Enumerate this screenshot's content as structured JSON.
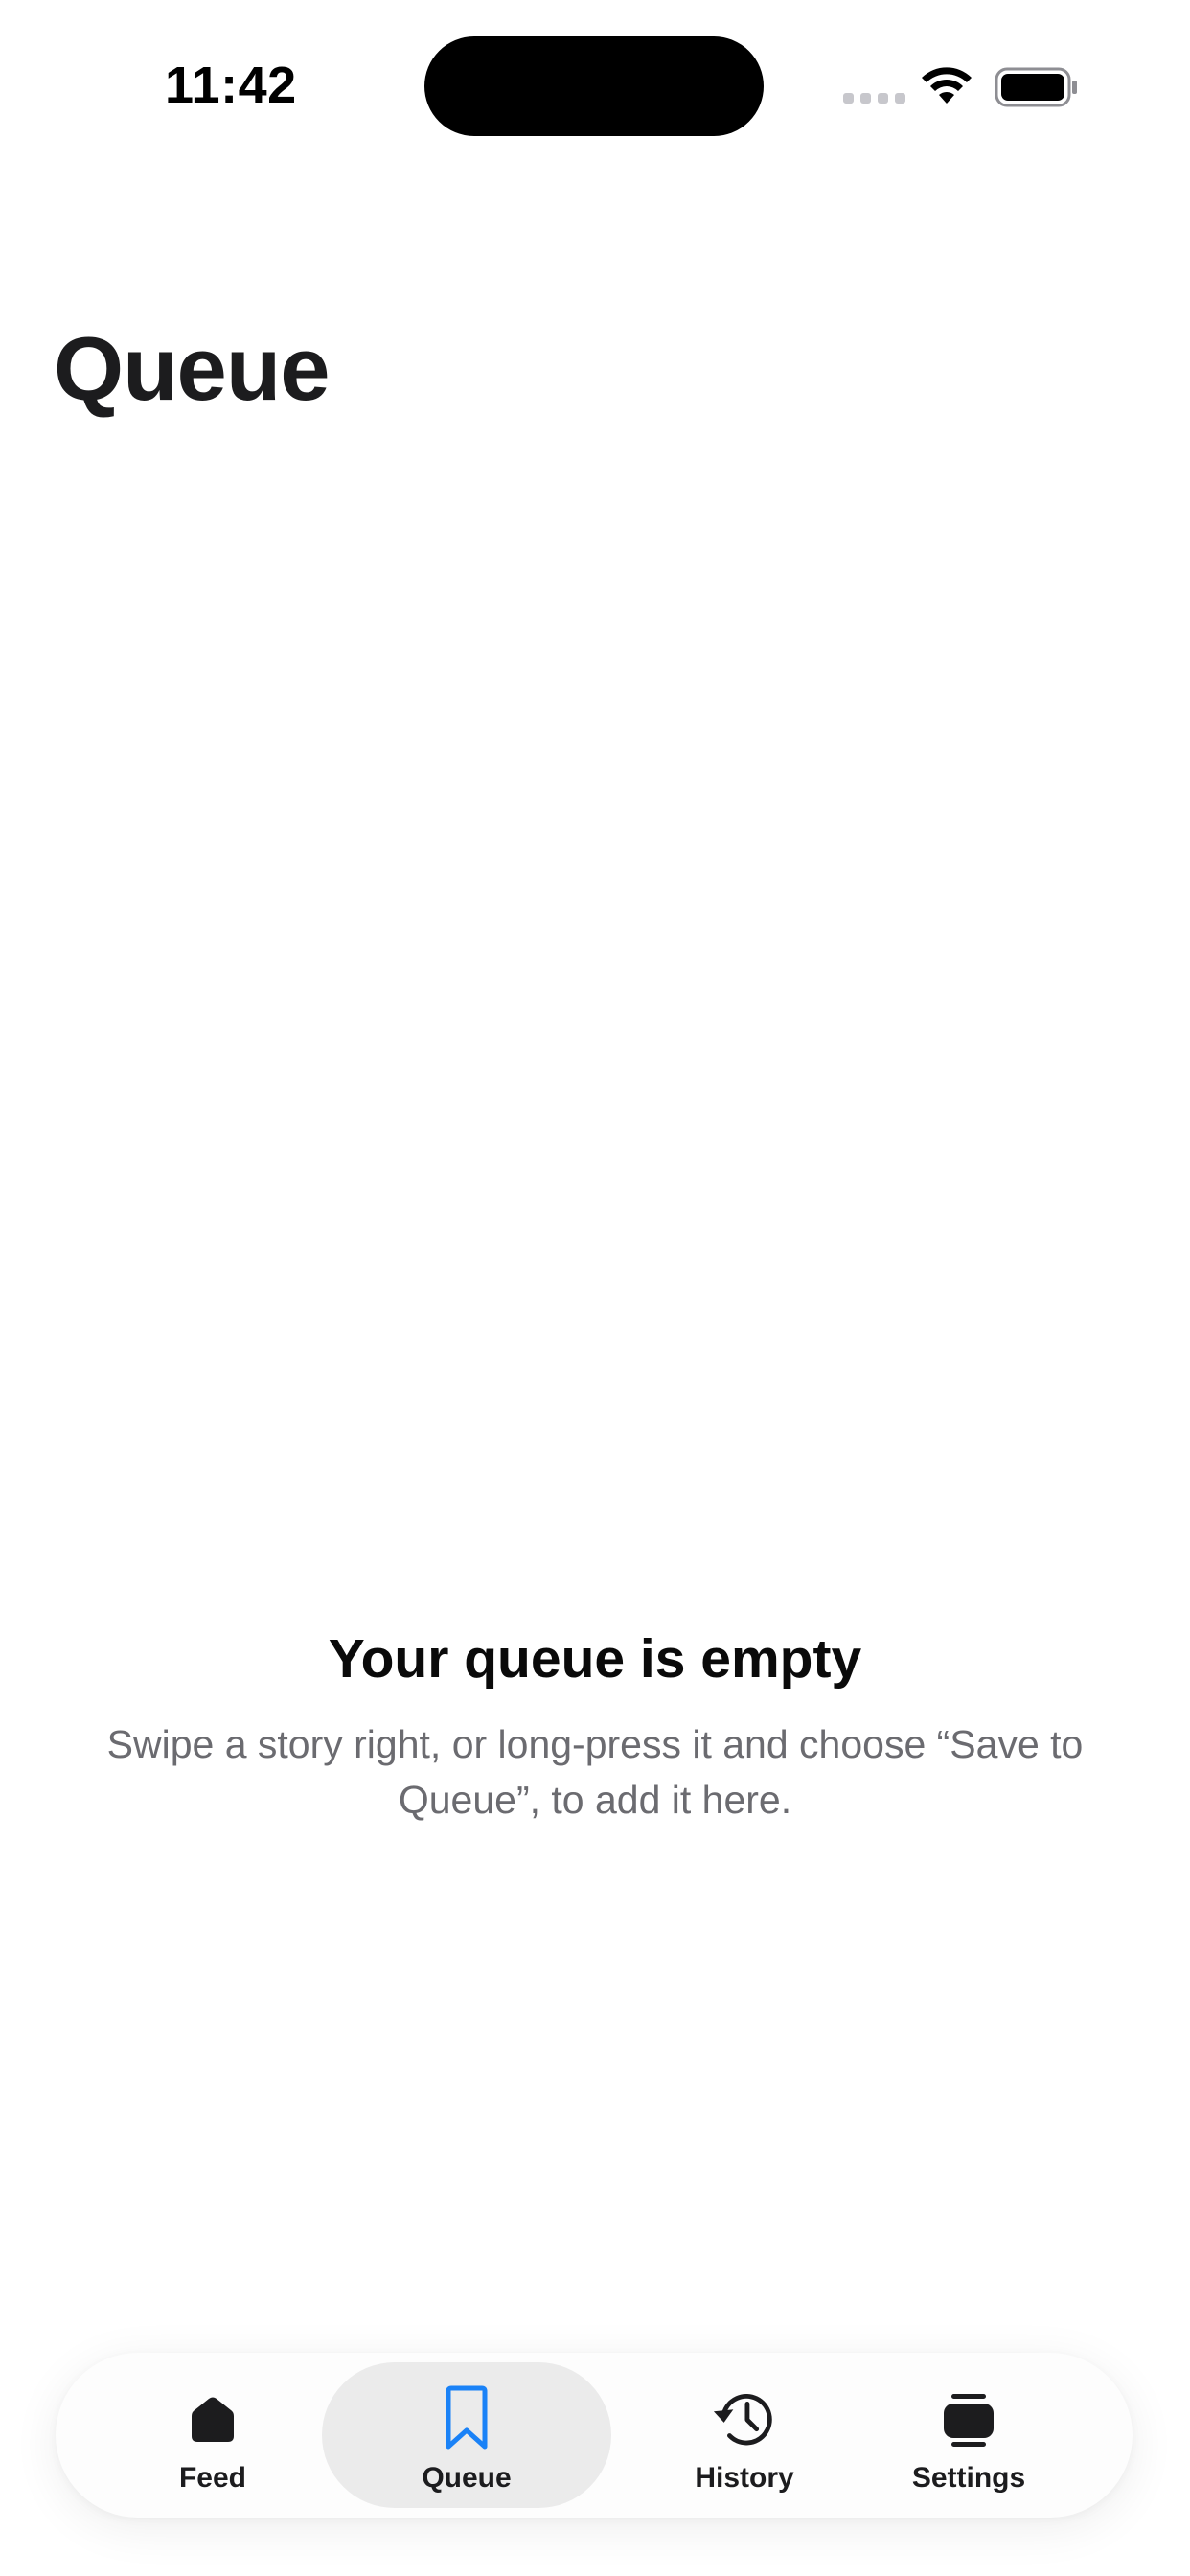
{
  "status_bar": {
    "time": "11:42",
    "icons": [
      "signal-dots-icon",
      "wifi-icon",
      "battery-icon"
    ]
  },
  "page": {
    "title": "Queue"
  },
  "empty_state": {
    "title": "Your queue is empty",
    "description": "Swipe a story right, or long-press it and choose “Save to Queue”, to add it here."
  },
  "tab_bar": {
    "active": "Queue",
    "accent_color": "#1a82f7",
    "items": [
      {
        "label": "Feed",
        "icon": "home-icon"
      },
      {
        "label": "Queue",
        "icon": "bookmark-icon"
      },
      {
        "label": "History",
        "icon": "history-icon"
      },
      {
        "label": "Settings",
        "icon": "settings-icon"
      }
    ]
  }
}
